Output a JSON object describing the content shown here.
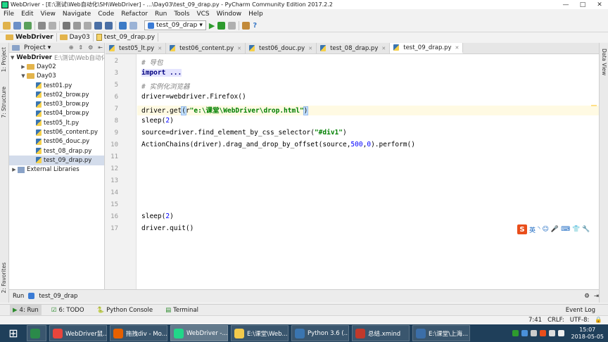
{
  "window": {
    "title": "WebDriver - [E:\\测试\\Web自动化\\SH\\WebDriver] - ...\\Day03\\test_09_drap.py - PyCharm Community Edition 2017.2.2"
  },
  "menu": [
    "File",
    "Edit",
    "View",
    "Navigate",
    "Code",
    "Refactor",
    "Run",
    "Tools",
    "VCS",
    "Window",
    "Help"
  ],
  "toolbar": {
    "run_config": "test_09_drap"
  },
  "breadcrumb": [
    "WebDriver",
    "Day03",
    "test_09_drap.py"
  ],
  "side_tabs": {
    "project": "1: Project",
    "structure": "7: Structure",
    "favorites": "2: Favorites",
    "data_view": "Data View"
  },
  "project_panel": {
    "title": "Project",
    "root": {
      "name": "WebDriver",
      "path": "E:\\测试\\Web自动化"
    },
    "tree": [
      {
        "label": "Day02",
        "kind": "folder",
        "depth": 1,
        "arrow": "▶"
      },
      {
        "label": "Day03",
        "kind": "folder",
        "depth": 1,
        "arrow": "▼"
      },
      {
        "label": "test01.py",
        "kind": "py",
        "depth": 2
      },
      {
        "label": "test02_brow.py",
        "kind": "py",
        "depth": 2
      },
      {
        "label": "test03_brow.py",
        "kind": "py",
        "depth": 2
      },
      {
        "label": "test04_brow.py",
        "kind": "py",
        "depth": 2
      },
      {
        "label": "test05_lt.py",
        "kind": "py",
        "depth": 2
      },
      {
        "label": "test06_content.py",
        "kind": "py",
        "depth": 2
      },
      {
        "label": "test06_douc.py",
        "kind": "py",
        "depth": 2
      },
      {
        "label": "test_08_drap.py",
        "kind": "py",
        "depth": 2
      },
      {
        "label": "test_09_drap.py",
        "kind": "py",
        "depth": 2,
        "selected": true
      },
      {
        "label": "External Libraries",
        "kind": "lib",
        "depth": 0,
        "arrow": "▶"
      }
    ]
  },
  "tabs": [
    {
      "label": "test05_lt.py",
      "active": false
    },
    {
      "label": "test06_content.py",
      "active": false
    },
    {
      "label": "test06_douc.py",
      "active": false
    },
    {
      "label": "test_08_drap.py",
      "active": false
    },
    {
      "label": "test_09_drap.py",
      "active": true
    }
  ],
  "code": [
    {
      "ln": "2",
      "html": "<span class=\"cm\"># 导包</span>"
    },
    {
      "ln": "3",
      "html": "<span class=\"kw fold\">import ...</span>"
    },
    {
      "ln": "5",
      "html": "<span class=\"cm\"># 实例化浏览器</span>"
    },
    {
      "ln": "6",
      "html": "driver=webdriver.Firefox()"
    },
    {
      "ln": "7",
      "html": "driver.get<span class=\"br\">(</span>r<span class=\"str\">\"e:\\课堂\\WebDriver\\drop.html\"</span><span class=\"br\">)</span>"
    },
    {
      "ln": "8",
      "html": "sleep(<span class=\"num\">2</span>)"
    },
    {
      "ln": "9",
      "html": "source=driver.find_element_by_css_selector(<span class=\"str\">\"#div1\"</span>)"
    },
    {
      "ln": "10",
      "html": "ActionChains(driver).drag_and_drop_by_offset(source,<span class=\"num\">500</span>,<span class=\"num\">0</span>).perform()"
    },
    {
      "ln": "11",
      "html": ""
    },
    {
      "ln": "12",
      "html": ""
    },
    {
      "ln": "13",
      "html": ""
    },
    {
      "ln": "14",
      "html": ""
    },
    {
      "ln": "15",
      "html": ""
    },
    {
      "ln": "16",
      "html": "sleep(<span class=\"num\">2</span>)"
    },
    {
      "ln": "17",
      "html": "driver.quit()"
    }
  ],
  "ime": {
    "logo": "S",
    "lang": "英"
  },
  "run_panel": {
    "label": "Run",
    "config": "test_09_drap"
  },
  "bottom_tabs": [
    {
      "label": "4: Run",
      "active": true,
      "icon": "▶"
    },
    {
      "label": "6: TODO",
      "active": false,
      "icon": "☑"
    },
    {
      "label": "Python Console",
      "active": false,
      "icon": "🐍"
    },
    {
      "label": "Terminal",
      "active": false,
      "icon": "▤"
    }
  ],
  "event_log": "Event Log",
  "status": {
    "position": "7:41",
    "line_sep": "CRLF:",
    "encoding": "UTF-8:"
  },
  "taskbar": {
    "items": [
      {
        "label": "",
        "color": "#2b8a4a"
      },
      {
        "label": "WebDriver鼠...",
        "color": "#e8453c"
      },
      {
        "label": "拖拽div - Mo...",
        "color": "#e66000"
      },
      {
        "label": "WebDriver -...",
        "color": "#21d789",
        "active": true
      },
      {
        "label": "E:\\课堂\\Web...",
        "color": "#f2c94c"
      },
      {
        "label": "Python 3.6 (...",
        "color": "#3a75b0"
      },
      {
        "label": "总结.xmind",
        "color": "#c0392b"
      },
      {
        "label": "E:\\课堂\\上海...",
        "color": "#3b6ea8"
      }
    ],
    "time": "15:07",
    "date": "2018-05-05"
  }
}
